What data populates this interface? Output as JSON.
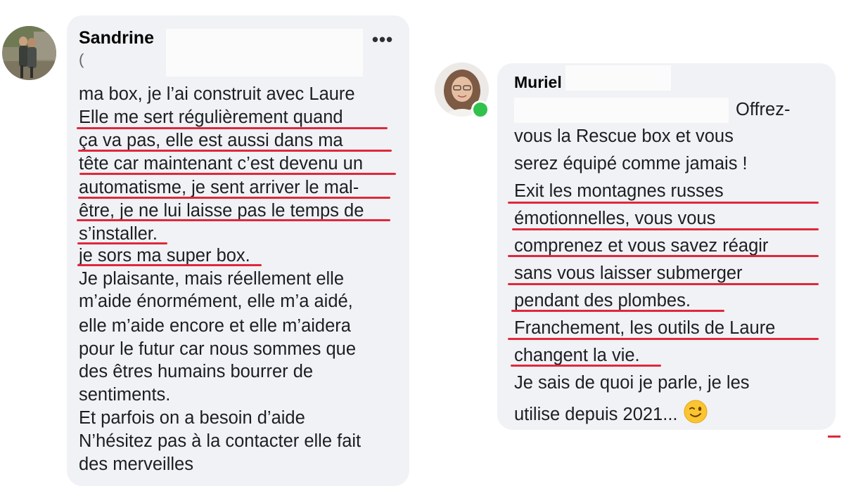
{
  "comment_1": {
    "author": "Sandrine",
    "subline": "(",
    "more_icon": "•••",
    "lines": [
      "ma box, je l’ai construit avec Laure",
      "Elle me sert régulièrement quand",
      "ça va pas, elle est aussi dans ma",
      "tête car maintenant c’est devenu un",
      "automatisme, je sent arriver le mal-",
      "être, je ne lui laisse pas le temps de",
      "s’installer.",
      "je sors ma super box.",
      "Je plaisante, mais réellement elle",
      "m’aide énormément, elle m’a aidé,",
      "elle m’aide encore et elle m’aidera",
      "pour le futur car nous sommes que",
      "des êtres humains bourrer de",
      "sentiments.",
      "Et parfois on a besoin d’aide",
      "N’hésitez pas à la contacter elle fait",
      "des merveilles"
    ]
  },
  "comment_2": {
    "author": "Muriel",
    "online_status": "online",
    "lines": [
      "Offrez-",
      "vous la Rescue box et vous",
      "serez équipé comme jamais !",
      "Exit les montagnes russes",
      "émotionnelles, vous vous",
      "comprenez et vous savez réagir",
      "sans vous laisser submerger",
      "pendant des plombes.",
      "Franchement, les outils de Laure",
      "changent la vie.",
      "Je sais de quoi je parle, je les",
      "utilise depuis 2021..."
    ],
    "emoji": "winking-face"
  },
  "colors": {
    "bubble": "#f0f2f5",
    "underline": "#e0283a",
    "online": "#31c24d"
  }
}
